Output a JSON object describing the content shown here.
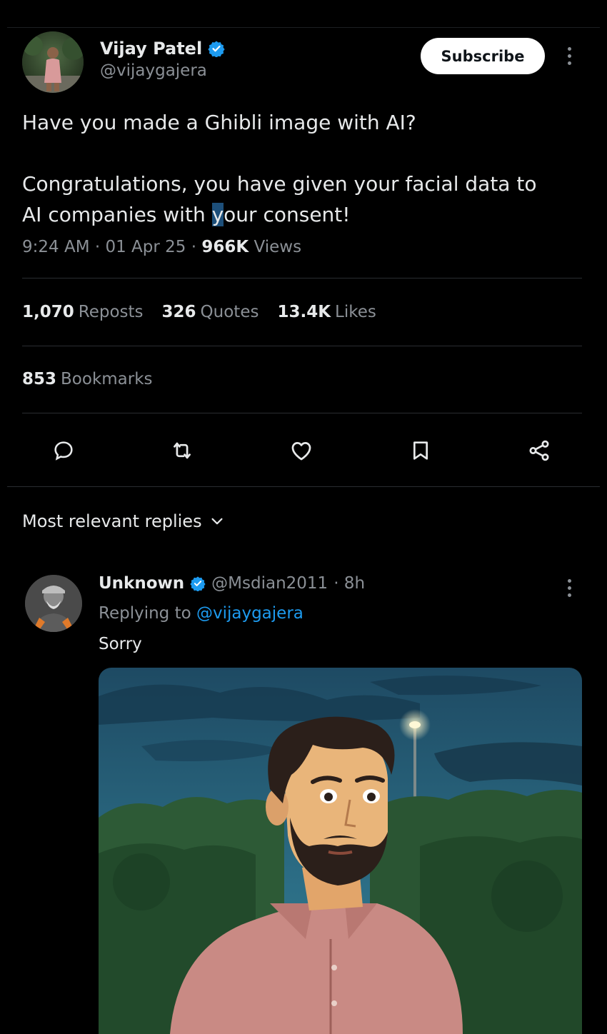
{
  "tweet": {
    "author_name": "Vijay Patel",
    "author_handle": "@vijaygajera",
    "subscribe_label": "Subscribe",
    "text_line1": "Have you made a Ghibli image with AI?",
    "text_line2": "Congratulations, you have given your facial data to",
    "text_line3_a": "AI companies with ",
    "text_line3_cursor": "y",
    "text_line3_b": "our consent!",
    "time": "9:24 AM",
    "date": "01 Apr 25",
    "views_count": "966K",
    "views_label": "Views",
    "sep": "·"
  },
  "stats": {
    "reposts_count": "1,070",
    "reposts_label": "Reposts",
    "quotes_count": "326",
    "quotes_label": "Quotes",
    "likes_count": "13.4K",
    "likes_label": "Likes",
    "bookmarks_count": "853",
    "bookmarks_label": "Bookmarks"
  },
  "actions": [
    "reply-icon",
    "repost-icon",
    "like-icon",
    "bookmark-icon",
    "share-icon"
  ],
  "replies": {
    "sort_label": "Most relevant replies"
  },
  "reply": {
    "name": "Unknown",
    "handle": "@Msdian2011",
    "time": "· 8h",
    "replying_prefix": "Replying to",
    "replying_handle": "@vijaygajera",
    "text": "Sorry"
  },
  "colors": {
    "background": "#000000",
    "text": "#e7e9ea",
    "secondary": "#8b9096",
    "accent": "#1d9bf0"
  }
}
